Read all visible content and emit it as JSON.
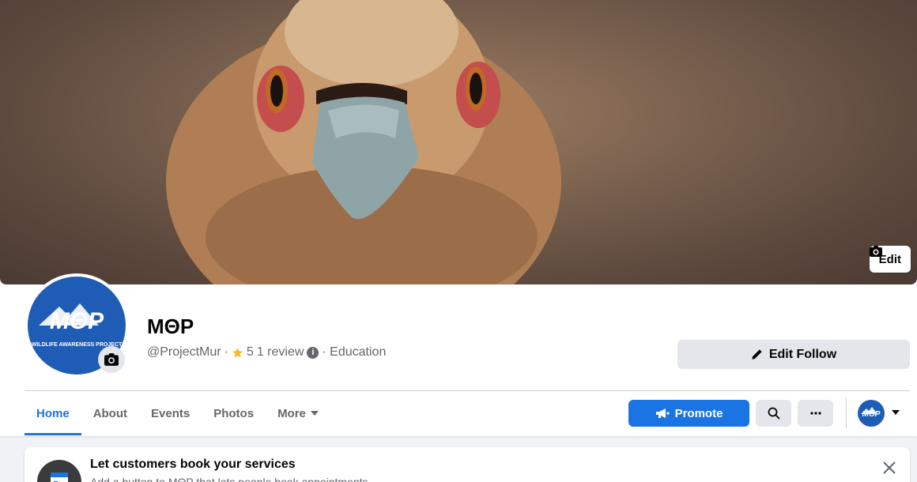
{
  "cover": {
    "edit_label": "Edit"
  },
  "profile": {
    "name": "MΘP",
    "handle": "@ProjectMur",
    "rating_prefix": "·",
    "rating": "5",
    "reviews": "1 review",
    "category": "· Education",
    "logo_text": "MΘP",
    "logo_caption": "WILDLIFE AWARENESS PROJECT"
  },
  "actions": {
    "edit_follow": "Edit Follow",
    "promote": "Promote"
  },
  "tabs": [
    {
      "label": "Home",
      "active": true
    },
    {
      "label": "About",
      "active": false
    },
    {
      "label": "Events",
      "active": false
    },
    {
      "label": "Photos",
      "active": false
    },
    {
      "label": "More",
      "active": false
    }
  ],
  "booking_card": {
    "title": "Let customers book your services",
    "subtitle": "Add a button to MΘP that lets people book appointments."
  },
  "colors": {
    "accent": "#1b74e4",
    "logo_blue": "#1f5cb5"
  }
}
